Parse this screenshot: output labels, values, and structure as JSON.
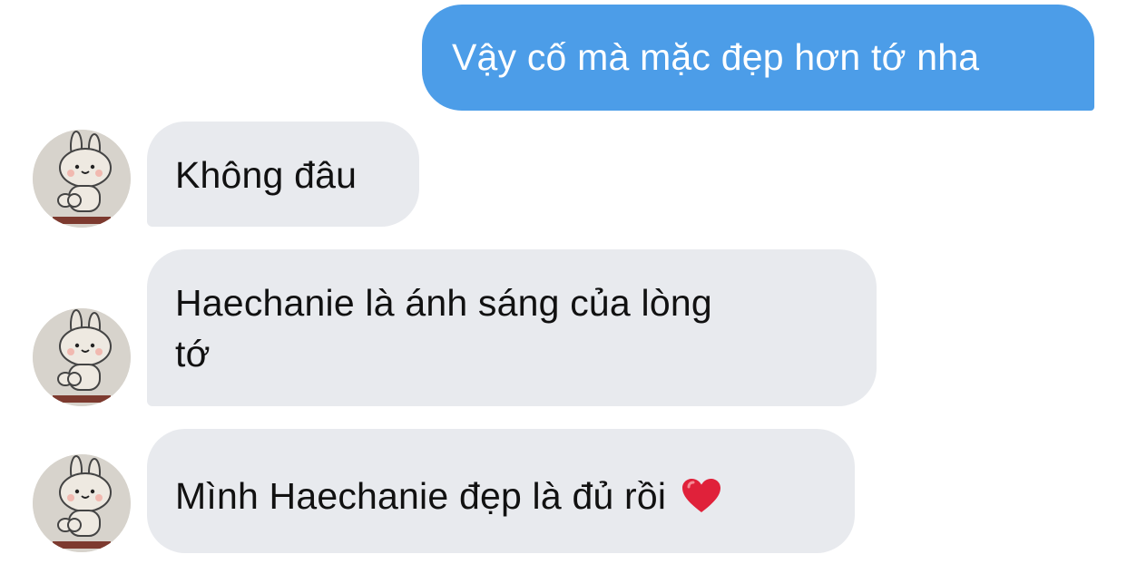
{
  "messages": [
    {
      "direction": "sent",
      "text": "Vậy cố mà mặc đẹp hơn tớ nha"
    },
    {
      "direction": "received",
      "text": "Không đâu"
    },
    {
      "direction": "received",
      "line1": "Haechanie là ánh sáng của lòng",
      "line2": "tớ"
    },
    {
      "direction": "received",
      "text": "Mình Haechanie đẹp là đủ rồi",
      "emoji": "heart-icon"
    }
  ],
  "colors": {
    "sent_bubble": "#4c9de8",
    "received_bubble": "#e8eaee",
    "received_text": "#111111",
    "heart": "#e0213a"
  }
}
